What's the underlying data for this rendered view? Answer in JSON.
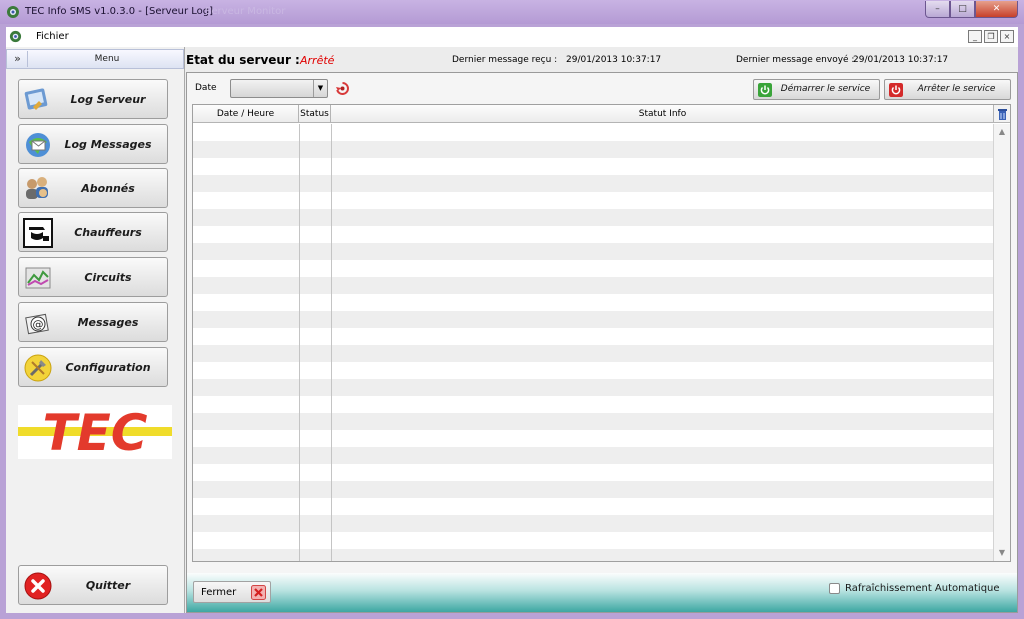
{
  "window": {
    "title": "TEC Info SMS v1.0.3.0 - [Serveur Log]",
    "faded_title": "Serveur Monitor",
    "min_glyph": "–",
    "max_glyph": "□",
    "close_glyph": "✕"
  },
  "menubar": {
    "fichier": "Fichier",
    "mdi_min": "_",
    "mdi_restore": "❐",
    "mdi_close": "×"
  },
  "menu": {
    "header": "Menu",
    "collapse_glyph": "»",
    "items": [
      {
        "label": "Log Serveur",
        "icon": "server-log-icon"
      },
      {
        "label": "Log Messages",
        "icon": "messages-log-icon"
      },
      {
        "label": "Abonnés",
        "icon": "users-icon"
      },
      {
        "label": "Chauffeurs",
        "icon": "driver-icon"
      },
      {
        "label": "Circuits",
        "icon": "circuits-icon"
      },
      {
        "label": "Messages",
        "icon": "email-icon"
      },
      {
        "label": "Configuration",
        "icon": "config-icon"
      }
    ],
    "logo_text": "TEC",
    "quit": "Quitter"
  },
  "status": {
    "etat_label": "Etat du serveur :",
    "etat_value": "Arrêté",
    "etat_color": "#e00000",
    "recu_label": "Dernier message reçu :",
    "recu_value": "29/01/2013 10:37:17",
    "envoye_label": "Dernier message envoyé :",
    "envoye_value": "29/01/2013 10:37:17"
  },
  "toolbar": {
    "date_label": "Date",
    "date_value": "",
    "combo_arrow": "▼",
    "start_service": "Démarrer le service",
    "stop_service": "Arrêter le service",
    "start_color": "#3aa43a",
    "stop_color": "#d42a2a"
  },
  "grid": {
    "columns": [
      "Date / Heure",
      "Status",
      "Statut Info"
    ],
    "rows": [],
    "scroll_up": "▲",
    "scroll_down": "▼"
  },
  "footer": {
    "close": "Fermer",
    "auto_refresh": "Rafraîchissement Automatique",
    "auto_refresh_checked": false
  }
}
